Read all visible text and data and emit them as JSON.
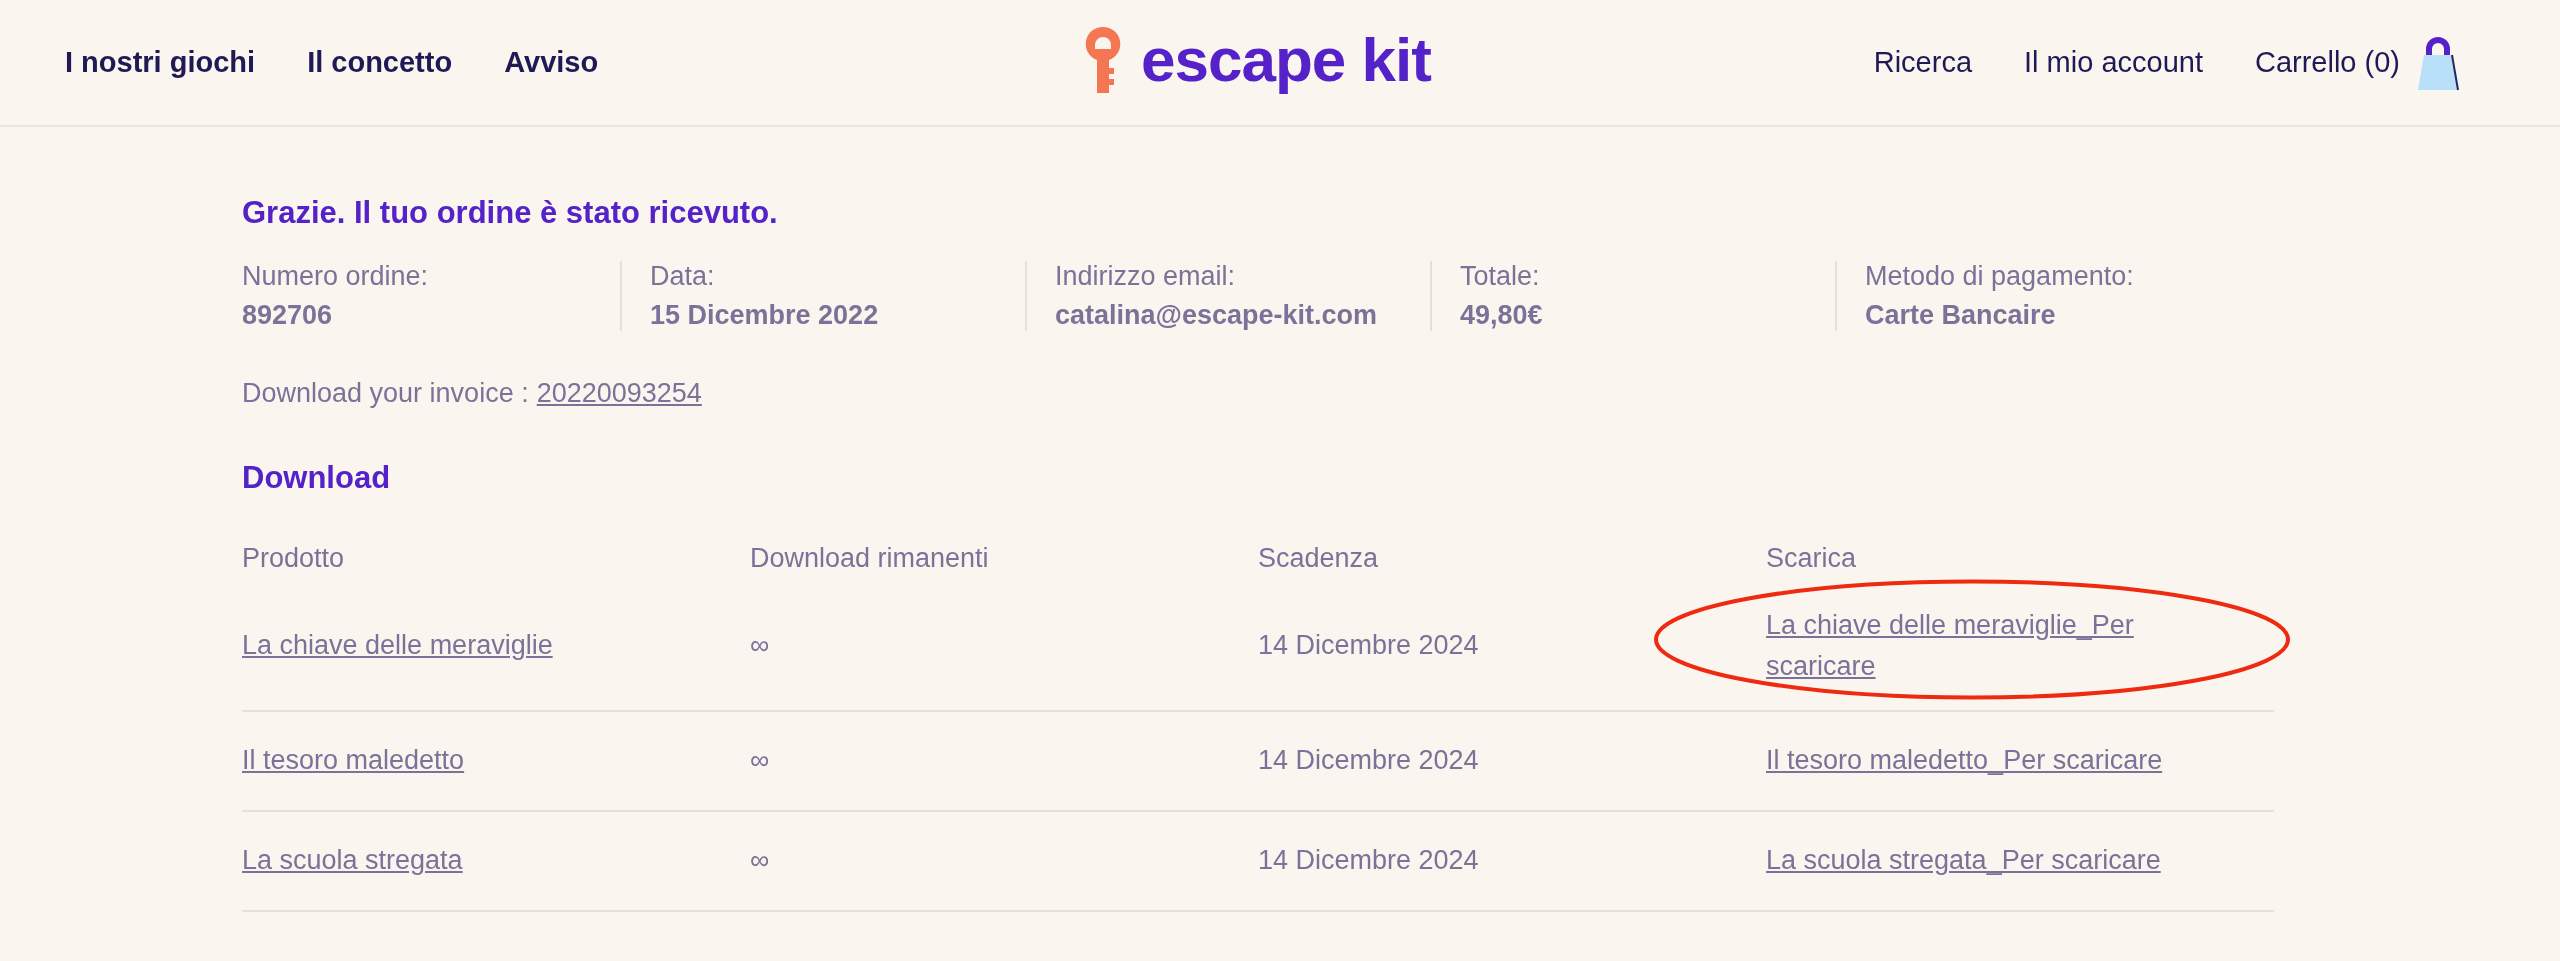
{
  "header": {
    "nav_left": [
      "I nostri giochi",
      "Il concetto",
      "Avviso"
    ],
    "logo": "escape kit",
    "nav_right": [
      "Ricerca",
      "Il mio account"
    ],
    "cart": "Carrello (0)"
  },
  "order": {
    "title": "Grazie. Il tuo ordine è stato ricevuto.",
    "details": [
      {
        "label": "Numero ordine:",
        "value": "892706"
      },
      {
        "label": "Data:",
        "value": "15 Dicembre 2022"
      },
      {
        "label": "Indirizzo email:",
        "value": "catalina@escape-kit.com"
      },
      {
        "label": "Totale:",
        "value": "49,80€"
      },
      {
        "label": "Metodo di pagamento:",
        "value": "Carte Bancaire"
      }
    ],
    "invoice_label": "Download your invoice :",
    "invoice_link": "20220093254"
  },
  "downloads": {
    "title": "Download",
    "columns": [
      "Prodotto",
      "Download rimanenti",
      "Scadenza",
      "Scarica"
    ],
    "rows": [
      {
        "product": "La chiave delle meraviglie",
        "remaining": "∞",
        "expires": "14 Dicembre 2024",
        "download": "La chiave delle meraviglie_Per scaricare",
        "circled": true
      },
      {
        "product": "Il tesoro maledetto",
        "remaining": "∞",
        "expires": "14 Dicembre 2024",
        "download": "Il tesoro maledetto_Per scaricare",
        "circled": false
      },
      {
        "product": "La scuola stregata",
        "remaining": "∞",
        "expires": "14 Dicembre 2024",
        "download": "La scuola stregata_Per scaricare",
        "circled": false
      }
    ]
  }
}
